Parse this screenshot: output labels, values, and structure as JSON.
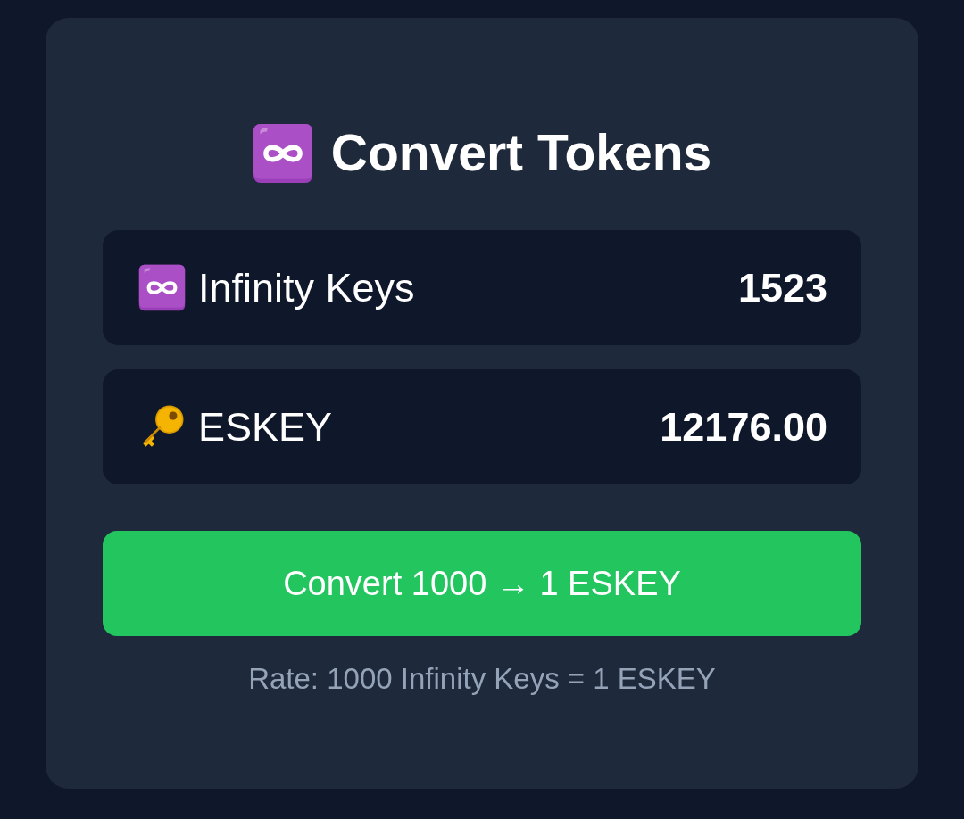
{
  "title": "Convert Tokens",
  "balances": [
    {
      "kind": "infinity",
      "name": "Infinity Keys",
      "amount": "1523"
    },
    {
      "kind": "key",
      "name": "ESKEY",
      "amount": "12176.00"
    }
  ],
  "convert_button": {
    "label": "Convert 1000 → 1 ESKEY"
  },
  "rate_note": "Rate: 1000 Infinity Keys = 1 ESKEY"
}
